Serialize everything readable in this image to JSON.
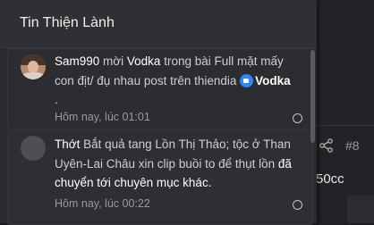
{
  "background": {
    "post_number": "#8",
    "partial_text": "50cc"
  },
  "popup": {
    "title": "Tin Thiện Lành"
  },
  "notifications": [
    {
      "user": "Sam990",
      "action": " mời ",
      "target_user": "Vodka",
      "context": " trong bài ",
      "thread": "Full mặt mấy con địt/ đụ nhau post trên thiendia",
      "mention": "Vodka",
      "trailing": ".",
      "time": "Hôm nay, lúc 01:01"
    },
    {
      "lead": "Thớt",
      "thread": " Bắt quả tang Lồn Thị Thảo; tộc ở Than Uyên-Lai Châu xin clip buồi to để thụt lồn ",
      "status": "đã chuyển tới chuyên mục khác.",
      "time": "Hôm nay, lúc 00:22"
    }
  ],
  "colors": {
    "popup_bg": "#2a2b2e",
    "page_bg": "#1b1c1e",
    "link": "#ffffff",
    "accent_blue": "#2d86ff"
  }
}
